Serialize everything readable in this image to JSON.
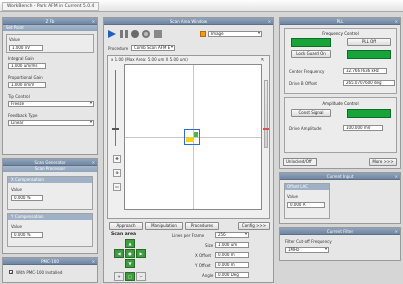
{
  "window": {
    "tab_title": "WorkBench - Park AFM in Current 5.0.4"
  },
  "left_panel": {
    "title": "Z Fb",
    "section_title": "Set Point",
    "set_point": {
      "label": "Value",
      "value": "1.000 nV"
    },
    "integral_gain": {
      "label": "Integral Gain",
      "value": "1.000 um/ms"
    },
    "proportional_gain": {
      "label": "Proportional Gain",
      "value": "1.000 nm/V"
    },
    "tip_control": {
      "label": "Tip Control",
      "value": "Freeze"
    },
    "feedback_type": {
      "label": "Feedback Type",
      "value": "Linear"
    }
  },
  "scan_generator": {
    "title": "Scan Generator",
    "subtitle": "Scan Processor",
    "x_comp": {
      "section": "X Compensation",
      "label": "Value",
      "value": "0.000 %"
    },
    "y_comp": {
      "section": "Y Compensation",
      "label": "Value",
      "value": "0.000 %"
    }
  },
  "pmc": {
    "title": "PMC-100",
    "checkbox_label": "With PMC-100 Installed"
  },
  "scan_area": {
    "title": "Scan Area Window",
    "toolbar_dropdown": "Image",
    "procedure_label": "Procedure",
    "procedure_value": "Comb Scan AFM E",
    "view_caption": "x 1.00 (Max Area: 5.00 um X 5.00 um)",
    "tabs": [
      "Approach",
      "Manipulation",
      "Procedures"
    ],
    "config_button": "Config >>>",
    "scan_area_label": "Scan area",
    "lines_per_frame_label": "Lines per Frame",
    "lines_per_frame_value": "256",
    "size_label": "Size",
    "size_value": "1.000 um",
    "x_offset_label": "X Offset",
    "x_offset_value": "0.000 m",
    "y_offset_label": "Y Offset",
    "y_offset_value": "0.000 m",
    "angle_label": "Angle",
    "angle_value": "0.000 Deg",
    "scan_speed_label": "Scan Speed",
    "scan_speed_value": "1.000 um/s"
  },
  "pll": {
    "title": "PLL",
    "freq_title": "Frequency Control",
    "pll_off": "PLL Off",
    "lock_guard": "Lock Guard On",
    "center_freq_label": "Center Frequency",
    "center_freq_value": "32.7667636 kHz",
    "drive_offset_label": "Drive B Offset",
    "drive_offset_value": "265.0707600 deg",
    "amp_title": "Amplitude Control",
    "const_signal": "Const Signal",
    "drive_amp_label": "Drive Amplitude",
    "drive_amp_value": "100.000 mV",
    "unlocked": "Unlocked/Off",
    "more": "More >>>"
  },
  "current_input": {
    "title": "Current Input",
    "section": "Offset LAC",
    "label": "Value",
    "value": "0.000 A"
  },
  "current_filter": {
    "title": "Current Filter",
    "label": "Filter Cut-off Frequency",
    "value": "1MHz"
  }
}
